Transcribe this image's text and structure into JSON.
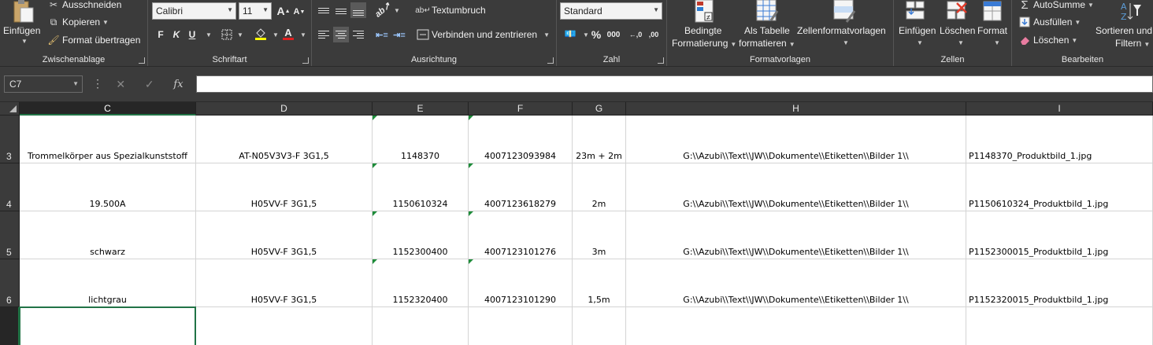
{
  "ribbon": {
    "clipboard": {
      "label": "Zwischenablage",
      "paste": "Einfügen",
      "cut": "Ausschneiden",
      "copy": "Kopieren",
      "format_painter": "Format übertragen"
    },
    "font": {
      "label": "Schriftart",
      "name": "Calibri",
      "size": "11",
      "bold": "F",
      "italic": "K",
      "underline": "U",
      "grow": "A",
      "shrink": "A",
      "font_color_letter": "A"
    },
    "alignment": {
      "label": "Ausrichtung",
      "wrap": "Textumbruch",
      "merge": "Verbinden und zentrieren"
    },
    "number": {
      "label": "Zahl",
      "format": "Standard",
      "percent": "%",
      "thousands": "000",
      "inc_dec": "←,0",
      "dec_dec": ",00"
    },
    "styles": {
      "label": "Formatvorlagen",
      "conditional_1": "Bedingte",
      "conditional_2": "Formatierung",
      "table_1": "Als Tabelle",
      "table_2": "formatieren",
      "cell_styles": "Zellenformatvorlagen"
    },
    "cells": {
      "label": "Zellen",
      "insert": "Einfügen",
      "delete": "Löschen",
      "format": "Format"
    },
    "editing": {
      "label": "Bearbeiten",
      "autosum": "AutoSumme",
      "fill": "Ausfüllen",
      "clear": "Löschen",
      "sort_1": "Sortieren und",
      "sort_2": "Filtern"
    }
  },
  "formula_bar": {
    "name_box": "C7",
    "fx": "fx",
    "cancel": "✕",
    "enter": "✓",
    "dots": "⋮",
    "value": ""
  },
  "grid": {
    "columns": [
      "C",
      "D",
      "E",
      "F",
      "G",
      "H",
      "I"
    ],
    "rows": [
      {
        "num": "3",
        "cells": [
          "Trommelkörper aus Spezialkunststoff",
          "AT-N05V3V3-F 3G1,5",
          "1148370",
          "4007123093984",
          "23m + 2m",
          "G:\\\\Azubi\\\\Text\\\\JW\\\\Dokumente\\\\Etiketten\\\\Bilder 1\\\\",
          "P1148370_Produktbild_1.jpg"
        ]
      },
      {
        "num": "4",
        "cells": [
          "19.500A",
          "H05VV-F 3G1,5",
          "1150610324",
          "4007123618279",
          "2m",
          "G:\\\\Azubi\\\\Text\\\\JW\\\\Dokumente\\\\Etiketten\\\\Bilder 1\\\\",
          "P1150610324_Produktbild_1.jpg"
        ]
      },
      {
        "num": "5",
        "cells": [
          "schwarz",
          "H05VV-F 3G1,5",
          "1152300400",
          "4007123101276",
          "3m",
          "G:\\\\Azubi\\\\Text\\\\JW\\\\Dokumente\\\\Etiketten\\\\Bilder 1\\\\",
          "P1152300015_Produktbild_1.jpg"
        ]
      },
      {
        "num": "6",
        "cells": [
          "lichtgrau",
          "H05VV-F 3G1,5",
          "1152320400",
          "4007123101290",
          "1,5m",
          "G:\\\\Azubi\\\\Text\\\\JW\\\\Dokumente\\\\Etiketten\\\\Bilder 1\\\\",
          "P1152320015_Produktbild_1.jpg"
        ]
      },
      {
        "num": "",
        "cells": [
          "",
          "",
          "",
          "",
          "",
          "",
          ""
        ]
      }
    ]
  },
  "colors": {
    "ribbon_bg": "#3b3b3b",
    "selection": "#217346",
    "error_triangle": "#1e8c3a"
  }
}
